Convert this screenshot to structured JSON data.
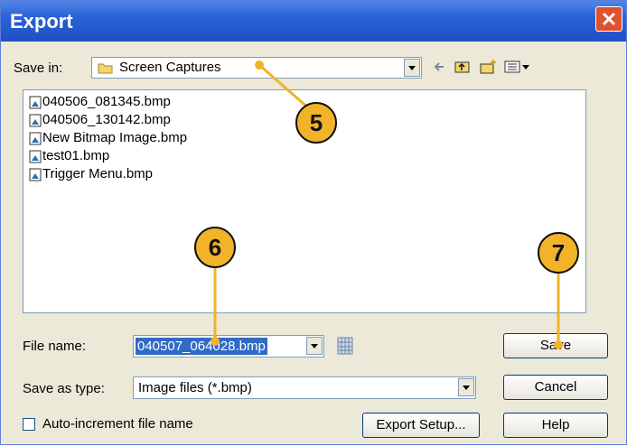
{
  "window": {
    "title": "Export",
    "close_icon": "close-x"
  },
  "save_in": {
    "label": "Save in:",
    "value": "Screen Captures",
    "folder_icon": "folder-icon"
  },
  "toolbar": {
    "back_icon": "back-arrow",
    "up_icon": "up-folder",
    "new_folder_icon": "new-folder",
    "view_menu_icon": "view-menu"
  },
  "files": [
    {
      "name": "040506_081345.bmp"
    },
    {
      "name": "040506_130142.bmp"
    },
    {
      "name": "New Bitmap Image.bmp"
    },
    {
      "name": "test01.bmp"
    },
    {
      "name": "Trigger Menu.bmp"
    }
  ],
  "file_name": {
    "label": "File name:",
    "value": "040507_064028.bmp"
  },
  "save_as_type": {
    "label": "Save as type:",
    "value": "Image files (*.bmp)"
  },
  "auto_increment": {
    "label": "Auto-increment file name",
    "checked": false
  },
  "buttons": {
    "save": "Save",
    "cancel": "Cancel",
    "help": "Help",
    "export_setup": "Export Setup..."
  },
  "callouts": [
    {
      "number": "5"
    },
    {
      "number": "6"
    },
    {
      "number": "7"
    }
  ],
  "colors": {
    "titlebar": "#2a62d8",
    "dialog_bg": "#ece9d8",
    "selection": "#316ac5",
    "callout": "#f1b32a"
  }
}
